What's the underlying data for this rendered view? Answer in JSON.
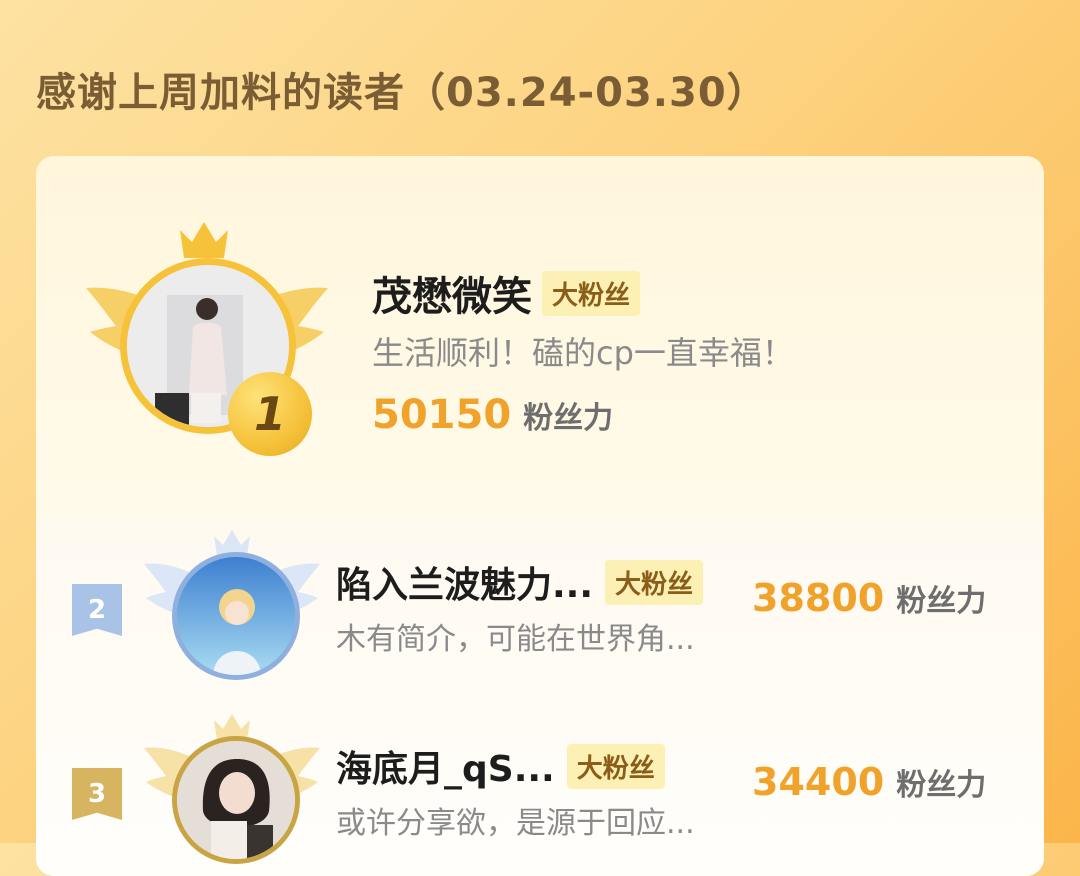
{
  "header": {
    "title": "感谢上周加料的读者（03.24-03.30）"
  },
  "fans": [
    {
      "rank": "1",
      "name": "茂懋微笑",
      "badge": "大粉丝",
      "bio": "生活顺利！磕的cp一直幸福！",
      "score": "50150",
      "unit": "粉丝力"
    },
    {
      "rank": "2",
      "name": "陷入兰波魅力...",
      "badge": "大粉丝",
      "bio": "木有简介，可能在世界角...",
      "score": "38800",
      "unit": "粉丝力"
    },
    {
      "rank": "3",
      "name": "海底月_qS...",
      "badge": "大粉丝",
      "bio": "或许分享欲，是源于回应...",
      "score": "34400",
      "unit": "粉丝力"
    }
  ],
  "colors": {
    "accent_score": "#f0a22a",
    "badge_bg": "#fdf0b4",
    "gold": "#f5c23a",
    "silver": "#a9c3e6",
    "bronze": "#d7b560"
  },
  "icons": {
    "crown": "crown-icon",
    "wings": "wings-icon",
    "medal": "rank-medal-icon"
  }
}
